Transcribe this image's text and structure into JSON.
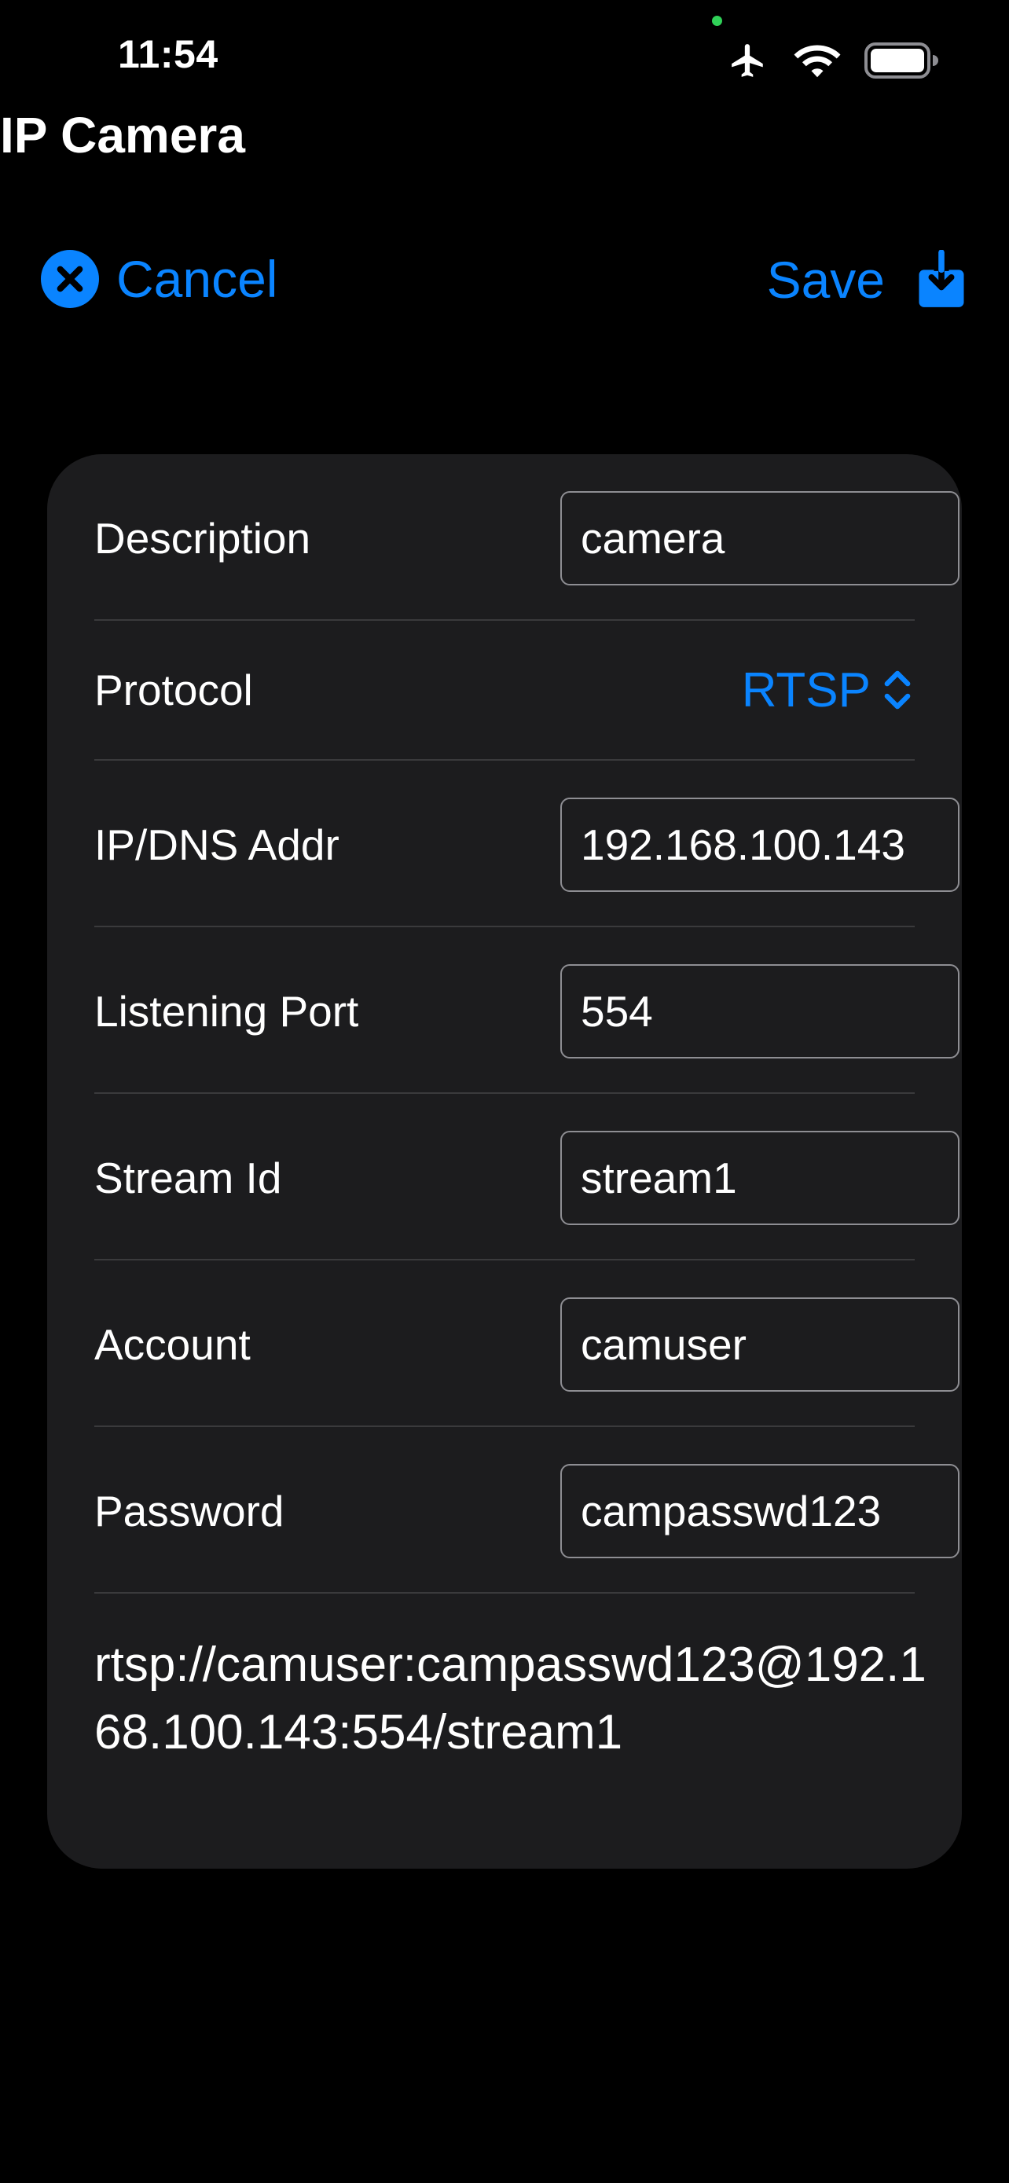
{
  "status_bar": {
    "time": "11:54"
  },
  "header": {
    "title": "IP Camera",
    "cancel_label": "Cancel",
    "save_label": "Save",
    "accent_color": "#0a84ff"
  },
  "form": {
    "description": {
      "label": "Description",
      "value": "camera"
    },
    "protocol": {
      "label": "Protocol",
      "value": "RTSP"
    },
    "ip_address": {
      "label": "IP/DNS Addr",
      "value": "192.168.100.143"
    },
    "listening_port": {
      "label": "Listening Port",
      "value": "554"
    },
    "stream_id": {
      "label": "Stream Id",
      "value": "stream1"
    },
    "account": {
      "label": "Account",
      "value": "camuser"
    },
    "password": {
      "label": "Password",
      "value": "campasswd123"
    },
    "url_preview": "rtsp://camuser:campasswd123@192.168.100.143:554/stream1"
  },
  "icons": {
    "cancel": "xmark-circle-icon",
    "save": "download-tray-icon",
    "protocol_picker": "chevron-up-down-icon",
    "status": [
      "airplane-icon",
      "wifi-icon",
      "battery-icon"
    ]
  }
}
